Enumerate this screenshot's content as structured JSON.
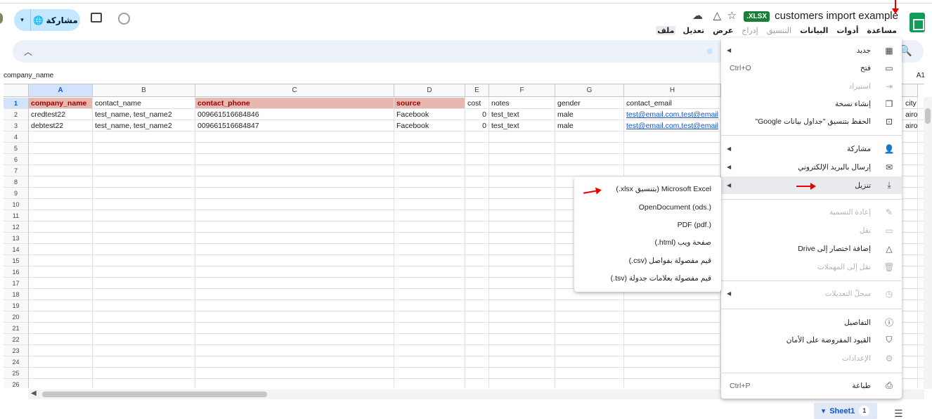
{
  "header": {
    "doc_title": "customers import example",
    "format_badge": ".XLSX",
    "share_label": "مشاركة"
  },
  "menubar": [
    "ملف",
    "تعديل",
    "عرض",
    "إدراج",
    "التنسيق",
    "البيانات",
    "أدوات",
    "مساعدة"
  ],
  "namebox": "company_name",
  "cell_ref": "A1",
  "grid": {
    "columns": [
      "A",
      "B",
      "C",
      "D",
      "E",
      "F",
      "G",
      "H"
    ],
    "rows": [
      "1",
      "2",
      "3",
      "4",
      "5",
      "6",
      "7",
      "8",
      "9",
      "10",
      "11",
      "12",
      "13",
      "14",
      "15",
      "16",
      "17",
      "18",
      "19",
      "20",
      "21",
      "22",
      "23",
      "24",
      "25",
      "26"
    ],
    "row1": [
      "company_name",
      "contact_name",
      "contact_phone",
      "source",
      "cost",
      "notes",
      "gender",
      "contact_email",
      "city"
    ],
    "row2": [
      "credtest22",
      "test_name, test_name2",
      "009661516684846",
      "Facebook",
      "0",
      "test_text",
      "male",
      "test@email.com,test@email",
      "airo"
    ],
    "row3": [
      "debtest22",
      "test_name, test_name2",
      "009661516684847",
      "Facebook",
      "0",
      "test_text",
      "male",
      "test@email.com,test@email",
      "airo"
    ]
  },
  "file_menu": {
    "new": "جديد",
    "open": "فتح",
    "open_shortcut": "Ctrl+O",
    "import": "استيراد",
    "copy": "إنشاء نسخة",
    "save_as_sheets": "الحفظ بتنسيق \"جداول بيانات Google\"",
    "share": "مشاركة",
    "email": "إرسال بالبريد الإلكتروني",
    "download": "تنزيل",
    "rename": "إعادة التسمية",
    "move": "نقل",
    "add_shortcut": "إضافة اختصار إلى Drive",
    "trash": "نقل إلى المهملات",
    "version_history": "سجلّ التعديلات",
    "details": "التفاصيل",
    "security": "القيود المفروضة على الأمان",
    "settings": "الإعدادات",
    "print": "طباعة",
    "print_shortcut": "Ctrl+P"
  },
  "download_menu": {
    "xlsx": "Microsoft Excel (بتنسيق xlsx.)",
    "ods": "OpenDocument (ods.)",
    "pdf": "PDF (pdf.)",
    "html": "صفحة ويب (html.)",
    "csv": "قيم مفصولة بفواصل (csv.)",
    "tsv": "قيم مفصولة بعلامات جدولة (tsv.)"
  },
  "footer": {
    "sheet_tab": "Sheet1",
    "sheet_count": "1"
  },
  "colors": {
    "header_fill": "#e6b8af",
    "header_text": "#990000",
    "accent": "#0b57d0",
    "badge": "#188038"
  }
}
